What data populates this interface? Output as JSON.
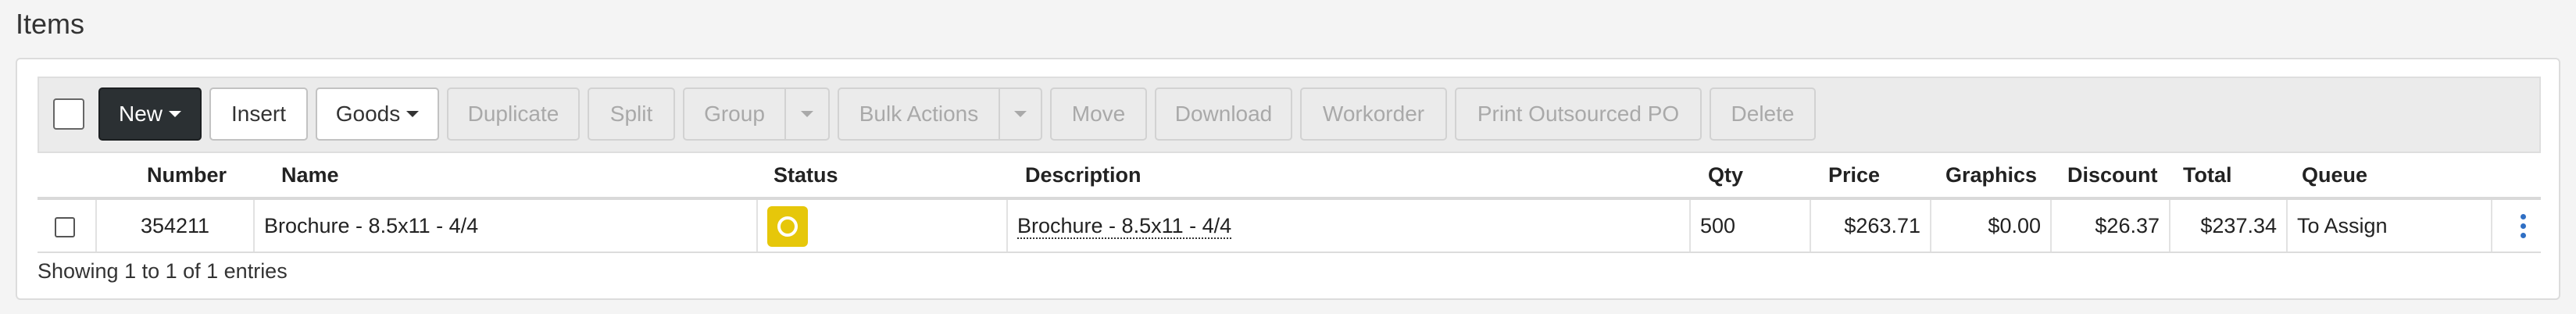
{
  "page": {
    "title": "Items"
  },
  "toolbar": {
    "new_label": "New",
    "insert_label": "Insert",
    "goods_label": "Goods",
    "duplicate_label": "Duplicate",
    "split_label": "Split",
    "group_label": "Group",
    "bulk_actions_label": "Bulk Actions",
    "move_label": "Move",
    "download_label": "Download",
    "workorder_label": "Workorder",
    "print_outsourced_po_label": "Print Outsourced PO",
    "delete_label": "Delete"
  },
  "table": {
    "columns": {
      "number": "Number",
      "name": "Name",
      "status": "Status",
      "description": "Description",
      "qty": "Qty",
      "price": "Price",
      "graphics": "Graphics",
      "discount": "Discount",
      "total": "Total",
      "queue": "Queue"
    },
    "rows": [
      {
        "number": "354211",
        "name": "Brochure - 8.5x11 - 4/4",
        "status_icon": "circle-status-icon",
        "status_color": "#e6c70a",
        "description": "Brochure - 8.5x11 - 4/4",
        "qty": "500",
        "price": "$263.71",
        "graphics": "$0.00",
        "discount": "$26.37",
        "total": "$237.34",
        "queue": "To Assign"
      }
    ],
    "footer": "Showing 1 to 1 of 1 entries"
  },
  "colors": {
    "accent_dark": "#2b3033",
    "kebab": "#2f6fc4"
  }
}
